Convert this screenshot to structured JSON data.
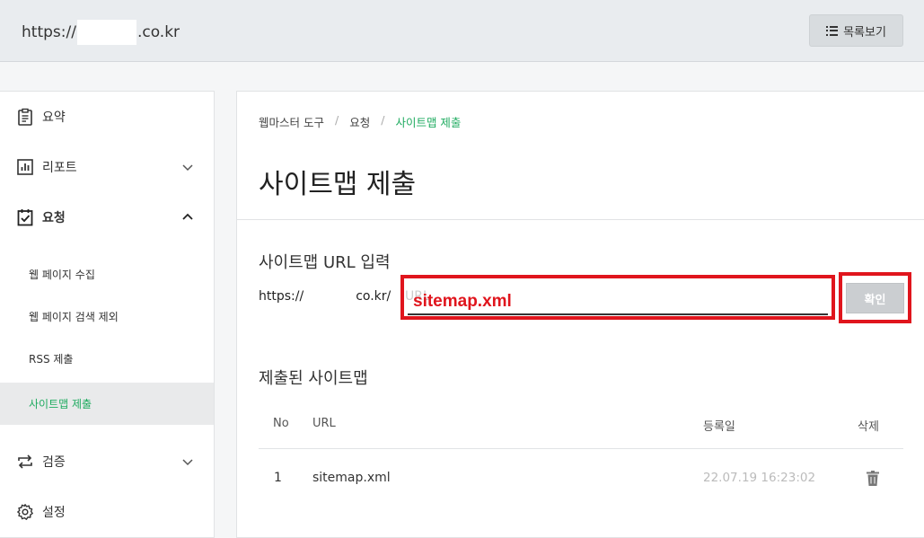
{
  "header": {
    "url_prefix": "https://",
    "url_suffix": ".co.kr",
    "list_button_label": "목록보기"
  },
  "sidebar": {
    "items": [
      {
        "label": "요약",
        "icon": "clipboard-icon"
      },
      {
        "label": "리포트",
        "icon": "bar-chart-icon"
      },
      {
        "label": "요청",
        "icon": "checklist-icon"
      },
      {
        "label": "웹 페이지 수집"
      },
      {
        "label": "웹 페이지 검색 제외"
      },
      {
        "label": "RSS 제출"
      },
      {
        "label": "사이트맵 제출"
      },
      {
        "label": "검증",
        "icon": "swap-icon"
      },
      {
        "label": "설정",
        "icon": "gear-icon"
      }
    ],
    "active_color": "#1fab60"
  },
  "breadcrumb": [
    "웹마스터 도구",
    "요청",
    "사이트맵 제출"
  ],
  "page_title": "사이트맵 제출",
  "url_section": {
    "title": "사이트맵 URL 입력",
    "prefix_start": "https://",
    "prefix_end": "co.kr/",
    "placeholder_tail": "URL",
    "input_value": "sitemap.xml",
    "confirm_label": "확인"
  },
  "submitted": {
    "title": "제출된 사이트맵",
    "columns": [
      "No",
      "URL",
      "등록일",
      "삭제"
    ],
    "rows": [
      {
        "no": "1",
        "url": "sitemap.xml",
        "date": "22.07.19 16:23:02"
      }
    ]
  },
  "colors": {
    "accent": "#1fab60",
    "highlight_box": "#e0151d"
  }
}
